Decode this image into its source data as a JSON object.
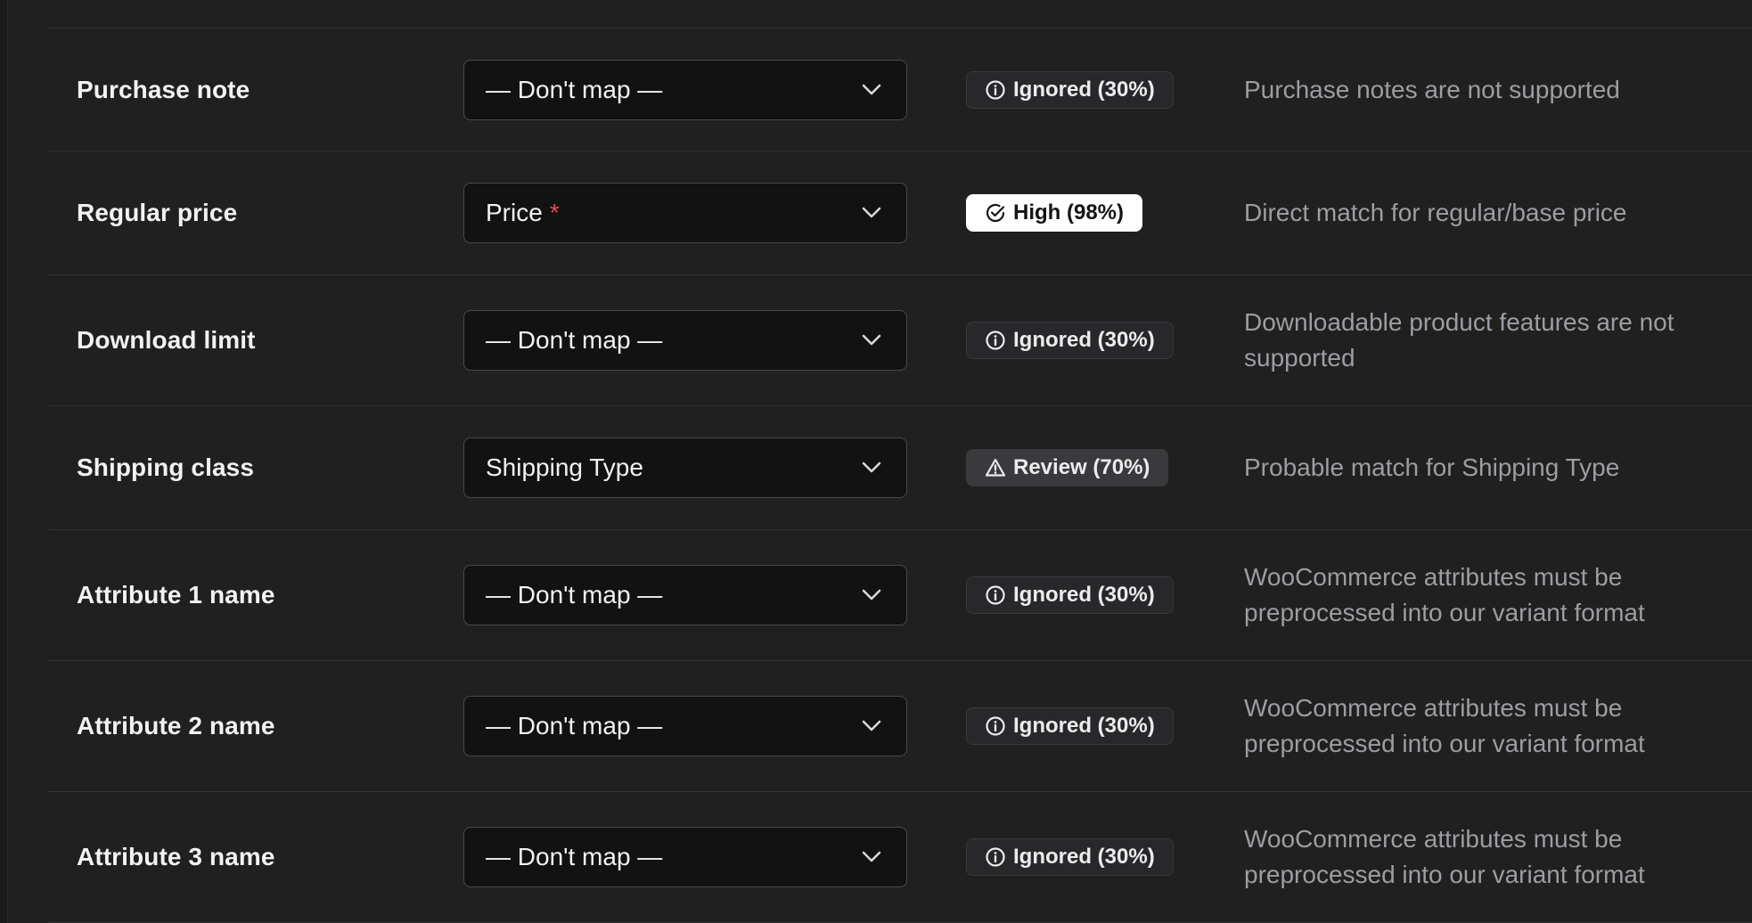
{
  "rows": [
    {
      "field": "Purchase note",
      "mapping": "— Don't map —",
      "required": false,
      "confidence": {
        "kind": "ignored",
        "label": "Ignored (30%)",
        "icon": "info-icon"
      },
      "note": "Purchase notes are not supported"
    },
    {
      "field": "Regular price",
      "mapping": "Price",
      "required": true,
      "required_mark": "*",
      "confidence": {
        "kind": "high",
        "label": "High (98%)",
        "icon": "check-circle-icon"
      },
      "note": "Direct match for regular/base price"
    },
    {
      "field": "Download limit",
      "mapping": "— Don't map —",
      "required": false,
      "confidence": {
        "kind": "ignored",
        "label": "Ignored (30%)",
        "icon": "info-icon"
      },
      "note": "Downloadable product features are not supported"
    },
    {
      "field": "Shipping class",
      "mapping": "Shipping Type",
      "required": false,
      "confidence": {
        "kind": "review",
        "label": "Review (70%)",
        "icon": "warning-icon"
      },
      "note": "Probable match for Shipping Type"
    },
    {
      "field": "Attribute 1 name",
      "mapping": "— Don't map —",
      "required": false,
      "confidence": {
        "kind": "ignored",
        "label": "Ignored (30%)",
        "icon": "info-icon"
      },
      "note": "WooCommerce attributes must be preprocessed into our variant format"
    },
    {
      "field": "Attribute 2 name",
      "mapping": "— Don't map —",
      "required": false,
      "confidence": {
        "kind": "ignored",
        "label": "Ignored (30%)",
        "icon": "info-icon"
      },
      "note": "WooCommerce attributes must be preprocessed into our variant format"
    },
    {
      "field": "Attribute 3 name",
      "mapping": "— Don't map —",
      "required": false,
      "confidence": {
        "kind": "ignored",
        "label": "Ignored (30%)",
        "icon": "info-icon"
      },
      "note": "WooCommerce attributes must be preprocessed into our variant format"
    }
  ],
  "colors": {
    "background": "#202021",
    "select_background": "#121213",
    "required_mark": "#e5484d",
    "badge_high_background": "#ffffff",
    "note_text": "#9d9da2"
  }
}
